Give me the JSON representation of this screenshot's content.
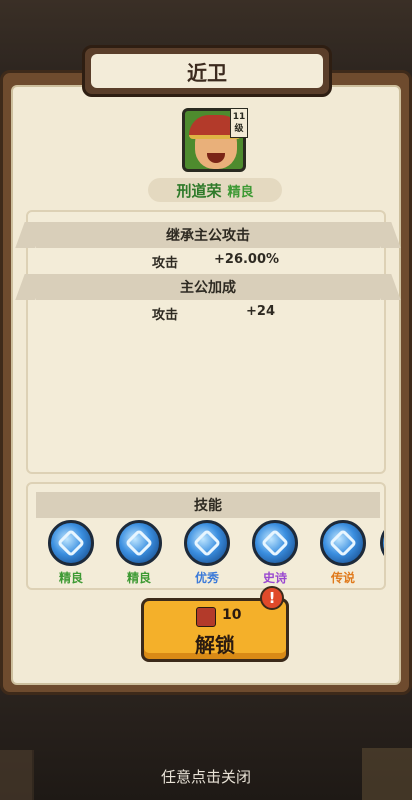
{
  "title": "近卫",
  "hero": {
    "name": "刑道荣",
    "quality": "精良",
    "level": "11",
    "level_suffix": "级",
    "quality_color": "#3e9a34"
  },
  "sections": {
    "inherit": {
      "title": "继承主公攻击",
      "stat_label": "攻击",
      "stat_value": "+26.00%"
    },
    "bonus": {
      "title": "主公加成",
      "stat_label": "攻击",
      "stat_value": "+24"
    },
    "skills": {
      "title": "技能",
      "items": [
        {
          "quality": "精良",
          "color": "#3e9a34"
        },
        {
          "quality": "精良",
          "color": "#3e9a34"
        },
        {
          "quality": "优秀",
          "color": "#3b7ad9"
        },
        {
          "quality": "史诗",
          "color": "#9a48d0"
        },
        {
          "quality": "传说",
          "color": "#e07a1c"
        }
      ]
    }
  },
  "unlock": {
    "cost": "10",
    "label": "解锁",
    "alert": "!"
  },
  "close_hint": "任意点击关闭"
}
